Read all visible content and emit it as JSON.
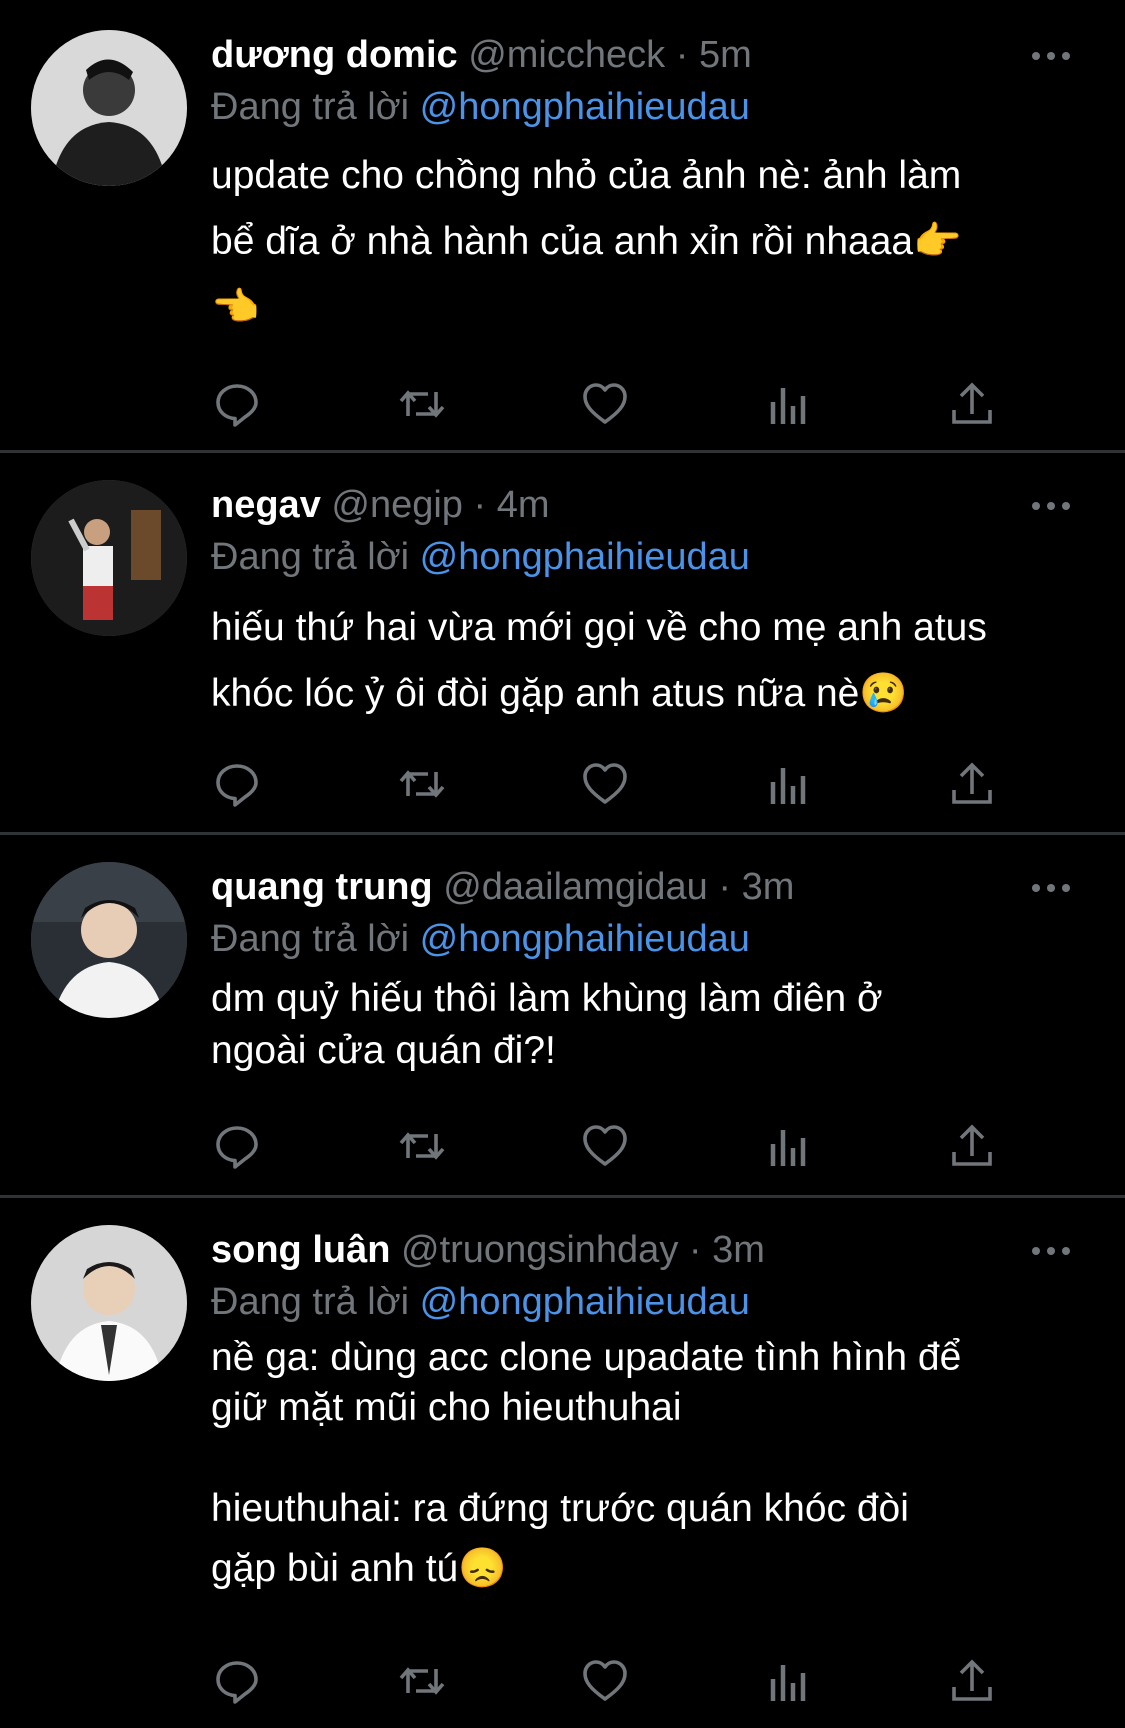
{
  "tweets": [
    {
      "name": "dương domic",
      "handle": "@miccheck",
      "dot": "·",
      "time": "5m",
      "reply_prefix": "Đang trả lời",
      "reply_to": "@hongphaihieudau",
      "lines": [
        "update cho chồng nhỏ của ảnh nè: ảnh làm",
        "bể dĩa ở nhà hành của anh xỉn rồi nhaaa👉",
        "👈"
      ]
    },
    {
      "name": "negav",
      "handle": "@negip",
      "dot": "·",
      "time": "4m",
      "reply_prefix": "Đang trả lời",
      "reply_to": "@hongphaihieudau",
      "lines": [
        "hiếu thứ hai vừa mới gọi về cho mẹ anh atus",
        "khóc lóc ỷ ôi đòi gặp anh atus nữa nè😢"
      ]
    },
    {
      "name": "quang trung",
      "handle": "@daailamgidau",
      "dot": "·",
      "time": "3m",
      "reply_prefix": "Đang trả lời",
      "reply_to": "@hongphaihieudau",
      "lines": [
        "dm quỷ hiếu thôi làm khùng làm điên ở",
        "ngoài cửa quán đi?!"
      ]
    },
    {
      "name": "song luân",
      "handle": "@truongsinhday",
      "dot": "·",
      "time": "3m",
      "reply_prefix": "Đang trả lời",
      "reply_to": "@hongphaihieudau",
      "lines": [
        "nề ga: dùng acc clone upadate tình hình để",
        "giữ mặt mũi cho hieuthuhai",
        "",
        "hieuthuhai: ra đứng trước quán khóc đòi",
        "gặp bùi anh tú😞"
      ]
    }
  ],
  "icons": [
    "more-icon",
    "reply-icon",
    "retweet-icon",
    "like-icon",
    "views-icon",
    "share-icon"
  ],
  "colors": {
    "background": "#000000",
    "text": "#ffffff",
    "muted": "#71767b",
    "mention": "#4a93e8",
    "divider": "#2f3336"
  }
}
